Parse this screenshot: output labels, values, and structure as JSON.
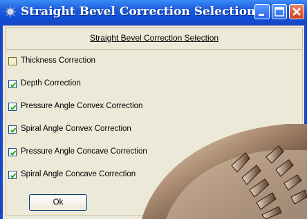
{
  "window": {
    "title": "Straight Bevel Correction Selection"
  },
  "header": {
    "label": "Straight Bevel Correction Selection"
  },
  "options": [
    {
      "label": "Thickness Correction",
      "checked": false
    },
    {
      "label": "Depth Correction",
      "checked": true
    },
    {
      "label": "Pressure Angle Convex Correction",
      "checked": true
    },
    {
      "label": "Spiral Angle Convex Correction",
      "checked": true
    },
    {
      "label": "Pressure Angle Concave Correction",
      "checked": true
    },
    {
      "label": "Spiral Angle Concave Correction",
      "checked": true
    }
  ],
  "buttons": {
    "ok_label": "Ok"
  },
  "colors": {
    "titlebar": "#1f5fe0",
    "close": "#c9421c",
    "face": "#ece9d8"
  }
}
